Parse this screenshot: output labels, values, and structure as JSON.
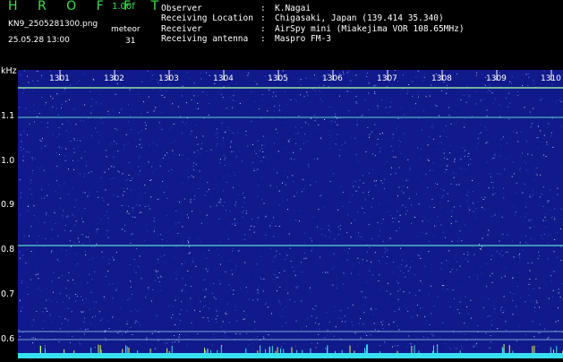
{
  "header": {
    "brand": "H R O F F T",
    "version": "1.00f",
    "filename": "KN9_2505281300.png",
    "datetime": "25.05.28 13:00",
    "meteor_label": "meteor",
    "meteor_count": "31"
  },
  "info": [
    {
      "key": "Observer",
      "value": "K.Nagai"
    },
    {
      "key": "Receiving Location",
      "value": "Chigasaki, Japan (139.414 35.340)"
    },
    {
      "key": "Receiver",
      "value": "AirSpy mini (Miakejima VOR 108.65MHz)"
    },
    {
      "key": "Receiving antenna",
      "value": "Maspro FM-3"
    }
  ],
  "y_axis": {
    "unit": "kHz",
    "ticks": [
      "1.1",
      "1.0",
      "0.9",
      "0.8",
      "0.7",
      "0.6"
    ]
  },
  "x_axis": {
    "ticks": [
      "1301",
      "1302",
      "1303",
      "1304",
      "1305",
      "1306",
      "1307",
      "1308",
      "1309",
      "1310"
    ]
  },
  "colors": {
    "background": "#101a8a",
    "brand": "#3ee04a",
    "tone_line": "#5ad8d0",
    "bottom_band": "#37e0f0"
  }
}
